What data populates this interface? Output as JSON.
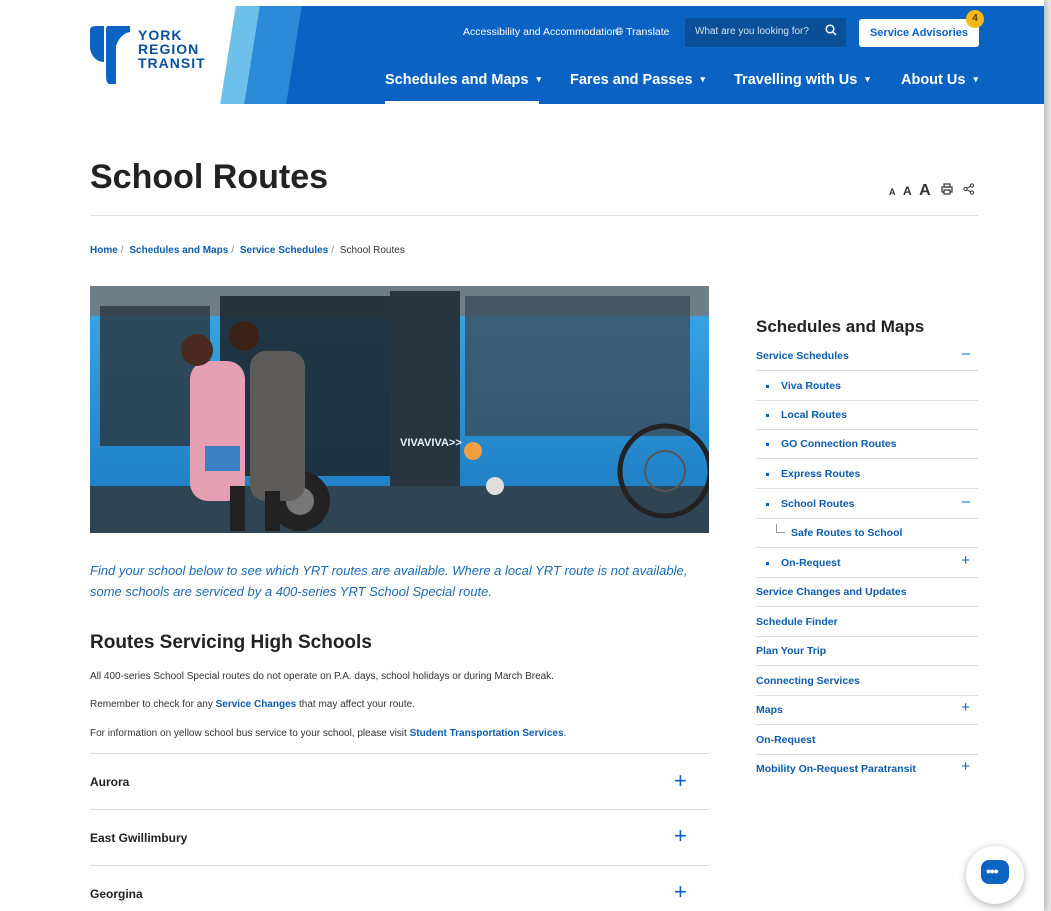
{
  "header": {
    "logo_lines": [
      "YORK",
      "REGION",
      "TRANSIT"
    ],
    "accessibility": "Accessibility and Accommodation",
    "translate": "Translate",
    "search_placeholder": "What are you looking for?",
    "advisories": "Service Advisories",
    "advisories_count": "4",
    "nav": [
      "Schedules and Maps",
      "Fares and Passes",
      "Travelling with Us",
      "About Us"
    ]
  },
  "page": {
    "title": "School Routes",
    "text_tools": [
      "A",
      "A",
      "A"
    ],
    "breadcrumb": [
      "Home",
      "Schedules and Maps",
      "Service Schedules",
      "School Routes"
    ],
    "intro": "Find your school below to see which YRT routes are available. Where a local YRT route is not available, some schools are serviced by a 400-series YRT School Special route.",
    "section_title": "Routes Servicing High Schools",
    "p1": "All 400-series School Special routes do not operate on P.A. days, school holidays or during March Break.",
    "p2_pre": "Remember to check for any ",
    "p2_link": "Service Changes",
    "p2_post": " that may affect your route.",
    "p3_pre": "For information on yellow school bus service to your school, please visit ",
    "p3_link": "Student Transportation Services",
    "p3_post": ".",
    "accordion": [
      "Aurora",
      "East Gwillimbury",
      "Georgina"
    ]
  },
  "sidebar": {
    "title": "Schedules and Maps",
    "items": [
      {
        "label": "Service Schedules",
        "marker": "–"
      },
      {
        "label": "Viva Routes",
        "marker": ""
      },
      {
        "label": "Local Routes",
        "marker": ""
      },
      {
        "label": "GO Connection Routes",
        "marker": ""
      },
      {
        "label": "Express Routes",
        "marker": ""
      },
      {
        "label": "School Routes",
        "marker": "–"
      },
      {
        "label": "Safe Routes to School",
        "marker": ""
      },
      {
        "label": "On-Request",
        "marker": "+"
      },
      {
        "label": "Service Changes and Updates",
        "marker": ""
      },
      {
        "label": "Schedule Finder",
        "marker": ""
      },
      {
        "label": "Plan Your Trip",
        "marker": ""
      },
      {
        "label": "Connecting Services",
        "marker": ""
      },
      {
        "label": "Maps",
        "marker": "+"
      },
      {
        "label": "On-Request",
        "marker": ""
      },
      {
        "label": "Mobility On-Request Paratransit",
        "marker": "+"
      }
    ]
  },
  "colors": {
    "brand_blue": "#0a63c2",
    "badge": "#f5b81c"
  }
}
